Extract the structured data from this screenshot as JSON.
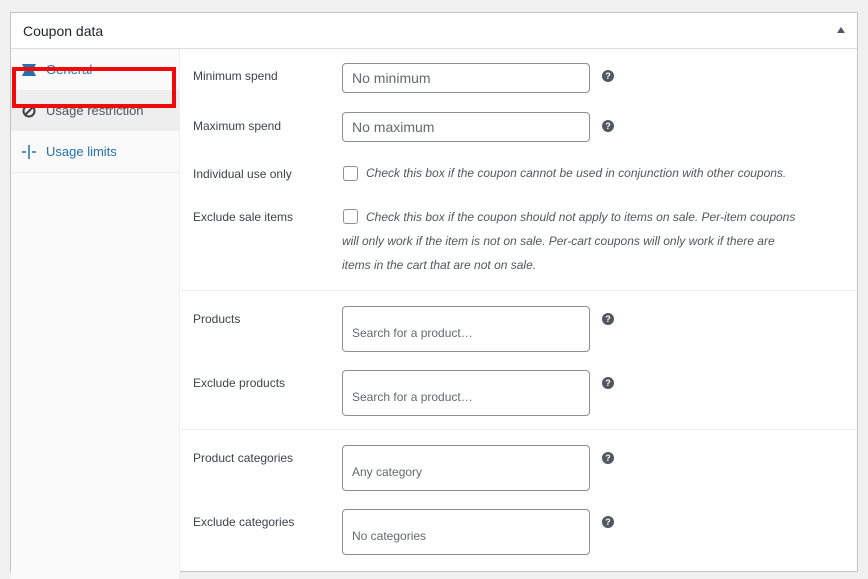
{
  "panel": {
    "title": "Coupon data"
  },
  "tabs": [
    {
      "label": "General",
      "icon": "ticket-icon"
    },
    {
      "label": "Usage restriction",
      "icon": "ban-icon"
    },
    {
      "label": "Usage limits",
      "icon": "limits-icon"
    }
  ],
  "active_tab": "Usage restriction",
  "fields": {
    "minimum_spend": {
      "label": "Minimum spend",
      "placeholder": "No minimum",
      "value": ""
    },
    "maximum_spend": {
      "label": "Maximum spend",
      "placeholder": "No maximum",
      "value": ""
    },
    "individual_use": {
      "label": "Individual use only",
      "description": "Check this box if the coupon cannot be used in conjunction with other coupons.",
      "checked": false
    },
    "exclude_sale": {
      "label": "Exclude sale items",
      "description_lines": [
        "Check this box if the coupon should not apply to items on sale. Per-item coupons",
        "will only work if the item is not on sale. Per-cart coupons will only work if there are",
        "items in the cart that are not on sale."
      ],
      "checked": false
    },
    "products": {
      "label": "Products",
      "placeholder": "Search for a product…"
    },
    "exclude_products": {
      "label": "Exclude products",
      "placeholder": "Search for a product…"
    },
    "product_categories": {
      "label": "Product categories",
      "placeholder": "Any category"
    },
    "exclude_categories": {
      "label": "Exclude categories",
      "placeholder": "No categories"
    }
  },
  "help_glyph": "?",
  "colors": {
    "link": "#2271b1",
    "highlight": "#f00a0a",
    "border": "#c3c4c7"
  }
}
